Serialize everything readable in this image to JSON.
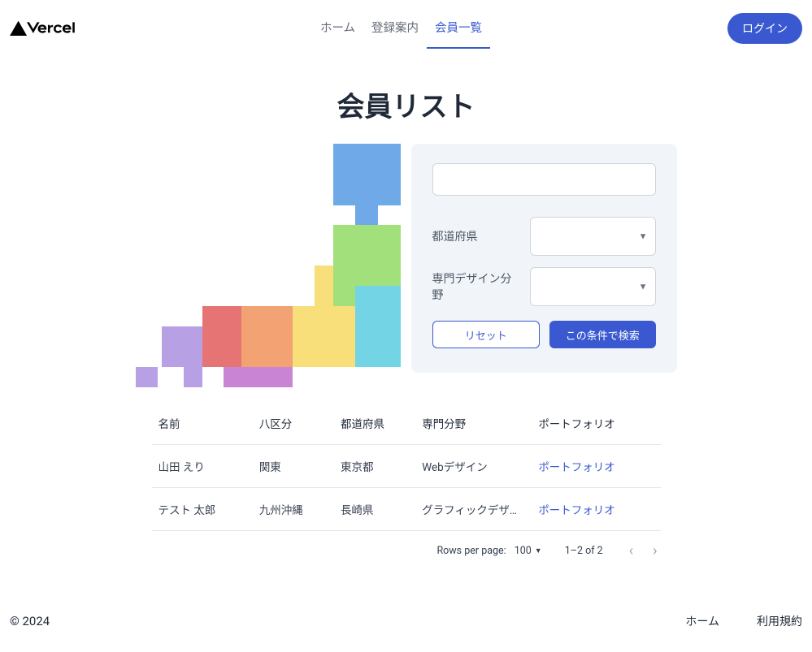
{
  "header": {
    "nav": {
      "home": "ホーム",
      "registration": "登録案内",
      "members": "会員一覧"
    },
    "login": "ログイン"
  },
  "page": {
    "title": "会員リスト"
  },
  "search": {
    "prefecture_label": "都道府県",
    "design_field_label": "専門デザイン分野",
    "reset": "リセット",
    "submit": "この条件で検索"
  },
  "table": {
    "headers": {
      "name": "名前",
      "region": "八区分",
      "prefecture": "都道府県",
      "specialty": "専門分野",
      "portfolio": "ポートフォリオ"
    },
    "rows": [
      {
        "name": "山田 えり",
        "region": "関東",
        "prefecture": "東京都",
        "specialty": "Webデザイン",
        "portfolio": "ポートフォリオ"
      },
      {
        "name": "テスト 太郎",
        "region": "九州沖縄",
        "prefecture": "長崎県",
        "specialty": "グラフィックデザ…",
        "portfolio": "ポートフォリオ"
      }
    ]
  },
  "pagination": {
    "rows_label": "Rows per page:",
    "rows_value": "100",
    "range": "1–2 of 2"
  },
  "footer": {
    "copyright": "© 2024",
    "home": "ホーム",
    "terms": "利用規約"
  }
}
